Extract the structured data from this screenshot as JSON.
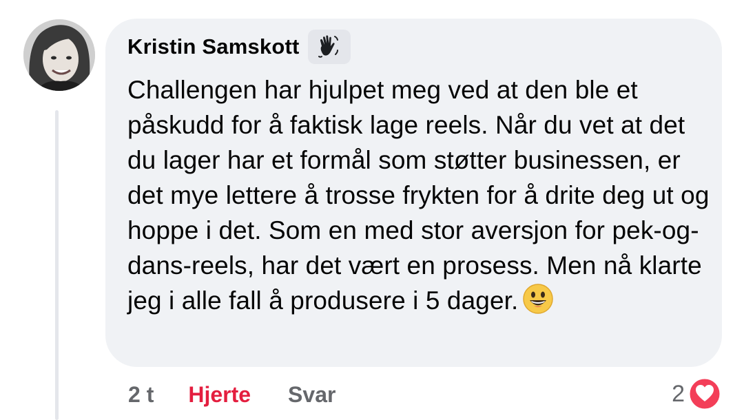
{
  "comment": {
    "author": "Kristin Samskott",
    "badge_icon": "waving-hand-icon",
    "text": "Challengen har hjulpet meg ved at den ble et påskudd for å faktisk lage reels. Når du vet at det du lager har et formål som støtter businessen, er det mye lettere å trosse frykten for å drite deg ut og hoppe i det. Som en med stor aversjon for pek-og-dans-reels, har det vært en prosess. Men nå klarte jeg i alle fall å produsere i 5 dager.",
    "emoji": "grinning-face-emoji"
  },
  "actions": {
    "time": "2 t",
    "reaction_label": "Hjerte",
    "reply_label": "Svar"
  },
  "reactions": {
    "count": "2",
    "icon": "heart-icon"
  },
  "colors": {
    "bubble": "#f0f2f5",
    "text": "#050505",
    "secondary": "#65676b",
    "heart": "#e41e3f"
  }
}
